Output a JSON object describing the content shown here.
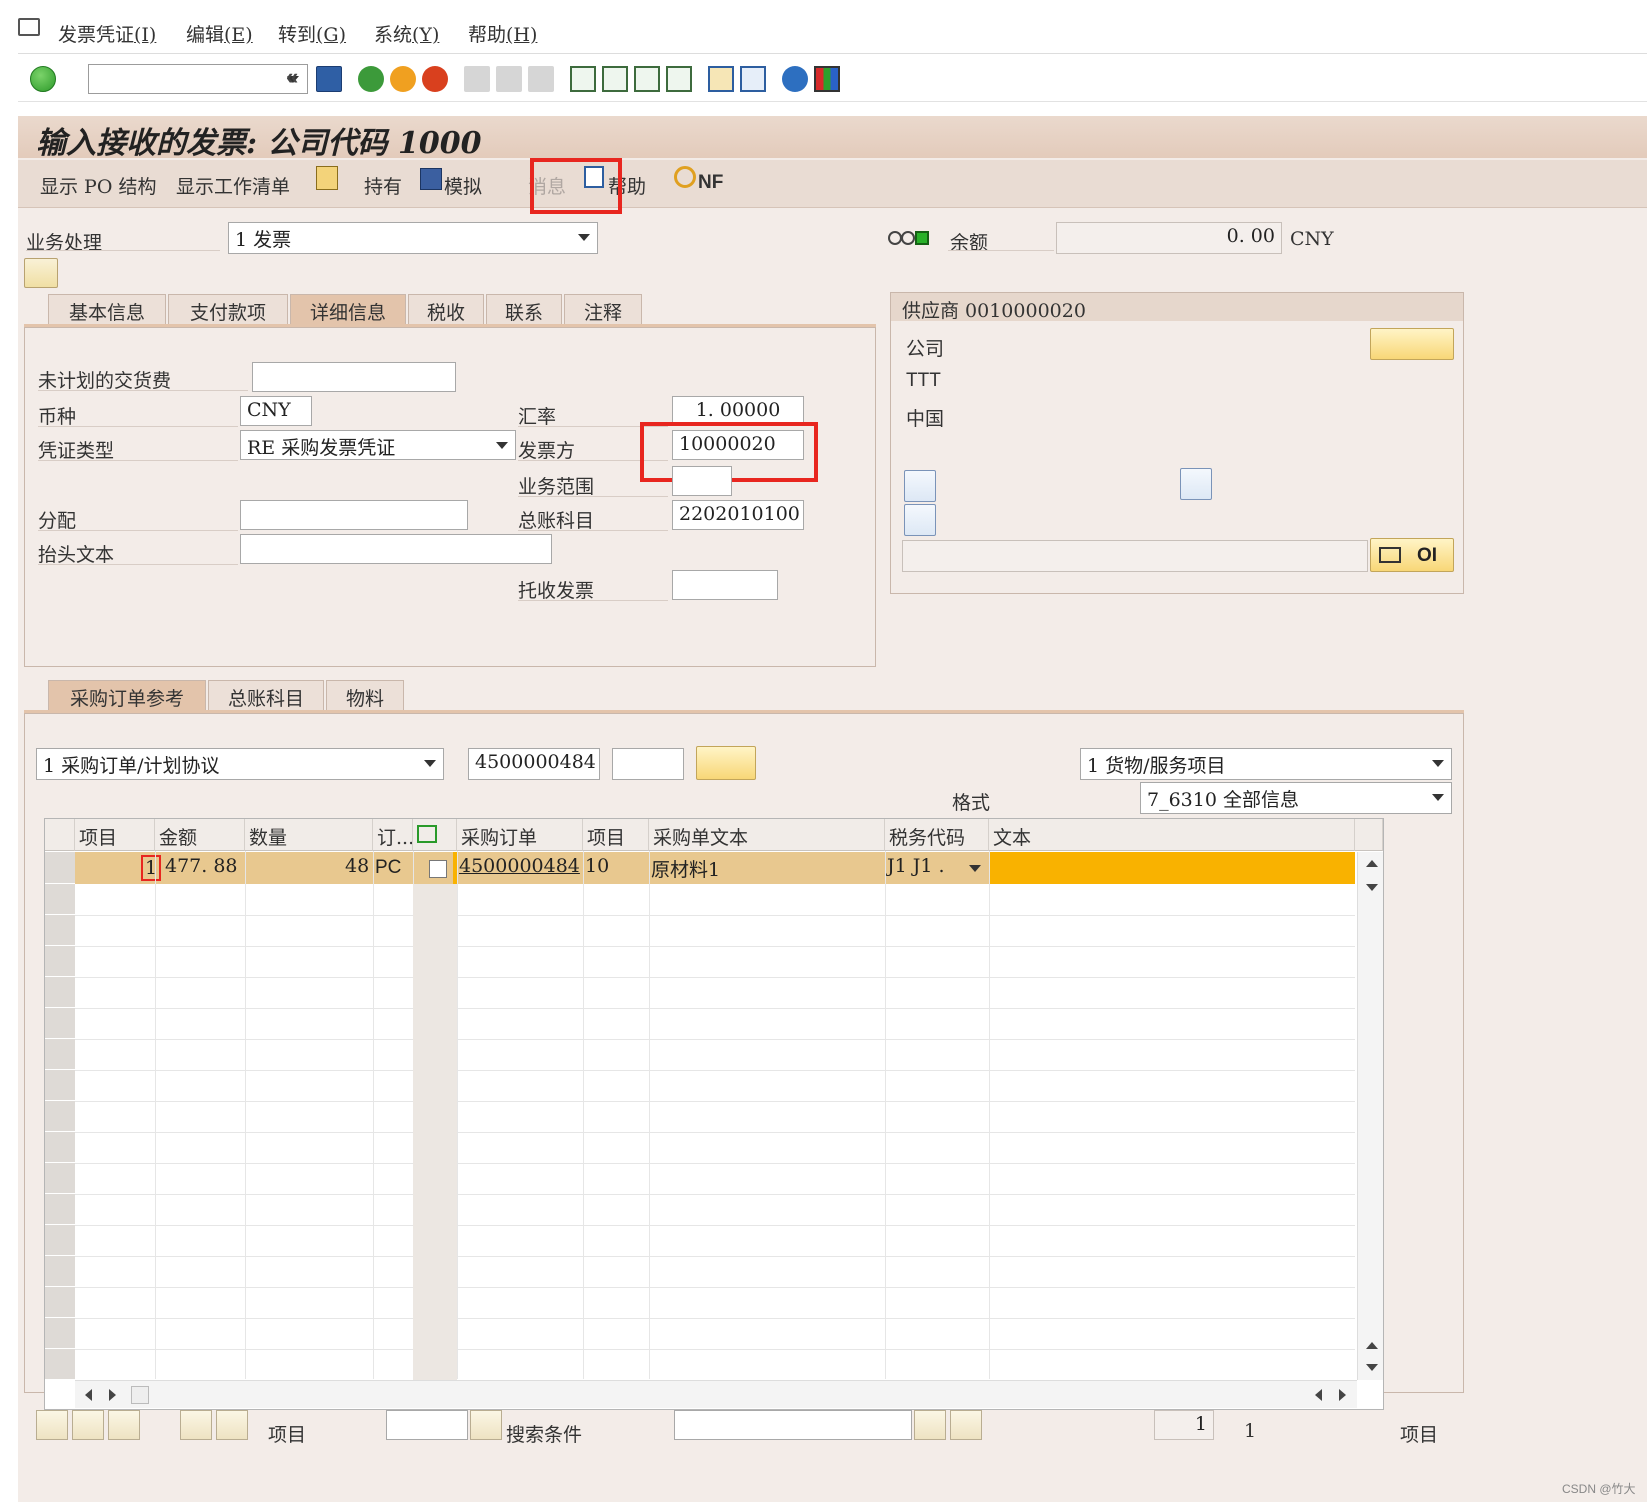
{
  "menu": [
    {
      "label": "发票凭证",
      "key": "(I)"
    },
    {
      "label": "编辑",
      "key": "(E)"
    },
    {
      "label": "转到",
      "key": "(G)"
    },
    {
      "label": "系统",
      "key": "(Y)"
    },
    {
      "label": "帮助",
      "key": "(H)"
    }
  ],
  "toolbar": {
    "command_value": "",
    "back_glyph": "«"
  },
  "title": "输入接收的发票: 公司代码 1000",
  "appbar": {
    "show_po_structure": "显示 PO 结构",
    "show_worklist": "显示工作清单",
    "hold": "持有",
    "simulate": "模拟",
    "messages": "消息",
    "help": "帮助",
    "nf": "NF"
  },
  "header": {
    "transaction_label": "业务处理",
    "transaction_value": "1 发票",
    "balance_label": "余额",
    "balance_value": "0. 00",
    "balance_currency": "CNY"
  },
  "tabs_top": [
    "基本信息",
    "支付款项",
    "详细信息",
    "税收",
    "联系",
    "注释"
  ],
  "details": {
    "unplanned_delivery_label": "未计划的交货费",
    "unplanned_delivery_value": "",
    "currency_label": "币种",
    "currency_value": "CNY",
    "exchange_rate_label": "汇率",
    "exchange_rate_value": "1. 00000",
    "doc_type_label": "凭证类型",
    "doc_type_value": "RE 采购发票凭证",
    "invoicing_party_label": "发票方",
    "invoicing_party_value": "10000020",
    "business_area_label": "业务范围",
    "business_area_value": "",
    "assignment_label": "分配",
    "assignment_value": "",
    "gl_account_label": "总账科目",
    "gl_account_value": "2202010100",
    "header_text_label": "抬头文本",
    "header_text_value": "",
    "collection_invoice_label": "托收发票",
    "collection_invoice_value": ""
  },
  "vendor": {
    "title": "供应商 0010000020",
    "company": "公司",
    "name": "TTT",
    "country": "中国",
    "oi_label": "OI"
  },
  "tabs_bottom": [
    "采购订单参考",
    "总账科目",
    "物料"
  ],
  "po_ref": {
    "ref_type": "1 采购订单/计划协议",
    "po_number": "4500000484",
    "item_field": "",
    "item_type": "1 货物/服务项目",
    "layout_label": "格式",
    "layout_value": "7_6310 全部信息"
  },
  "grid": {
    "headers": [
      "项目",
      "金额",
      "数量",
      "订...",
      "",
      "采购订单",
      "项目",
      "采购单文本",
      "税务代码",
      "文本"
    ],
    "row": {
      "item": "1",
      "amount": "477. 88",
      "quantity": "48",
      "unit": "PC",
      "po": "4500000484",
      "po_item": "10",
      "po_text": "原材料1",
      "tax_code": "J1  J1  ."
    }
  },
  "footer": {
    "item_label": "项目",
    "search_label": "搜索条件",
    "page_value": "1",
    "page_total": "1",
    "item_label_right": "项目"
  },
  "watermark": "CSDN @竹大",
  "colors": {
    "selected_row": "#f9b200",
    "red_highlight": "#e8261f",
    "title_bg": "#e3cbbb"
  }
}
